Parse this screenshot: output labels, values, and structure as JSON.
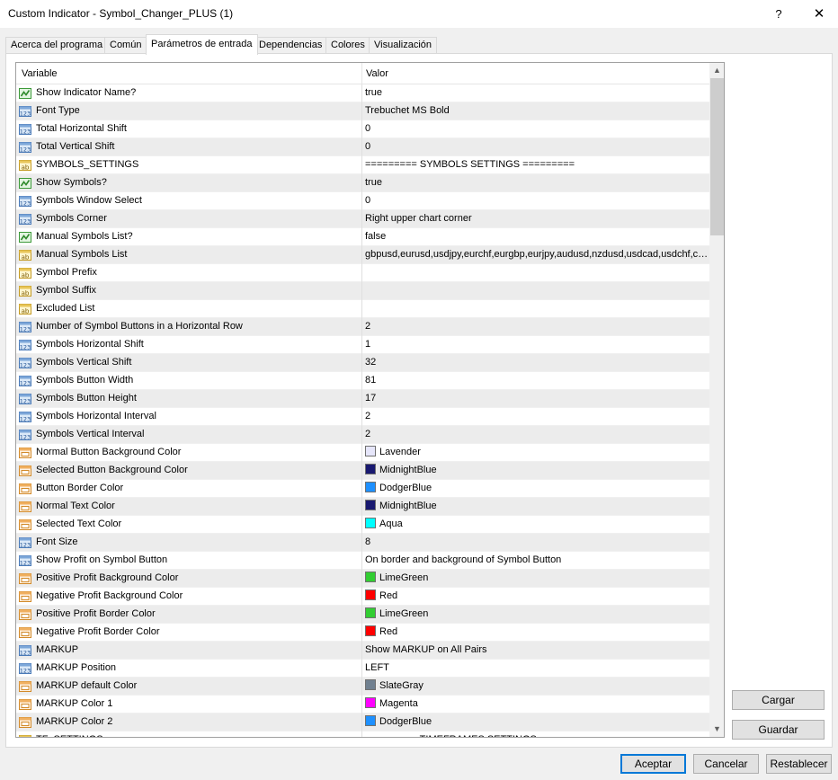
{
  "window": {
    "title": "Custom Indicator - Symbol_Changer_PLUS (1)",
    "help_label": "?",
    "close_label": "✕"
  },
  "tabs": [
    {
      "label": "Acerca del programa",
      "active": false
    },
    {
      "label": "Común",
      "active": false
    },
    {
      "label": "Parámetros de entrada",
      "active": true
    },
    {
      "label": "Dependencias",
      "active": false
    },
    {
      "label": "Colores",
      "active": false
    },
    {
      "label": "Visualización",
      "active": false
    }
  ],
  "grid": {
    "headers": {
      "variable": "Variable",
      "value": "Valor"
    },
    "rows": [
      {
        "type": "bool",
        "name": "Show Indicator Name?",
        "value": "true"
      },
      {
        "type": "int",
        "name": "Font Type",
        "value": "Trebuchet MS Bold"
      },
      {
        "type": "int",
        "name": "Total Horizontal Shift",
        "value": "0"
      },
      {
        "type": "int",
        "name": "Total Vertical Shift",
        "value": "0"
      },
      {
        "type": "string",
        "name": "SYMBOLS_SETTINGS",
        "value": "========= SYMBOLS SETTINGS ========="
      },
      {
        "type": "bool",
        "name": "Show Symbols?",
        "value": "true"
      },
      {
        "type": "int",
        "name": "Symbols Window Select",
        "value": "0"
      },
      {
        "type": "int",
        "name": "Symbols Corner",
        "value": "Right upper chart corner"
      },
      {
        "type": "bool",
        "name": "Manual Symbols List?",
        "value": "false"
      },
      {
        "type": "string",
        "name": "Manual Symbols List",
        "value": "gbpusd,eurusd,usdjpy,eurchf,eurgbp,eurjpy,audusd,nzdusd,usdcad,usdchf,ch..."
      },
      {
        "type": "string",
        "name": "Symbol Prefix",
        "value": ""
      },
      {
        "type": "string",
        "name": "Symbol Suffix",
        "value": ""
      },
      {
        "type": "string",
        "name": "Excluded List",
        "value": ""
      },
      {
        "type": "int",
        "name": "Number of Symbol Buttons in a Horizontal Row",
        "value": "2"
      },
      {
        "type": "int",
        "name": "Symbols Horizontal Shift",
        "value": "1"
      },
      {
        "type": "int",
        "name": "Symbols Vertical Shift",
        "value": "32"
      },
      {
        "type": "int",
        "name": "Symbols Button Width",
        "value": "81"
      },
      {
        "type": "int",
        "name": "Symbols Button Height",
        "value": "17"
      },
      {
        "type": "int",
        "name": "Symbols Horizontal Interval",
        "value": "2"
      },
      {
        "type": "int",
        "name": "Symbols Vertical Interval",
        "value": "2"
      },
      {
        "type": "color",
        "name": "Normal Button Background Color",
        "value": "Lavender",
        "swatch": "#e6e6fa"
      },
      {
        "type": "color",
        "name": "Selected Button Background Color",
        "value": "MidnightBlue",
        "swatch": "#191970"
      },
      {
        "type": "color",
        "name": "Button Border Color",
        "value": "DodgerBlue",
        "swatch": "#1e90ff"
      },
      {
        "type": "color",
        "name": "Normal Text Color",
        "value": "MidnightBlue",
        "swatch": "#191970"
      },
      {
        "type": "color",
        "name": "Selected Text Color",
        "value": "Aqua",
        "swatch": "#00ffff"
      },
      {
        "type": "int",
        "name": "Font Size",
        "value": "8"
      },
      {
        "type": "int",
        "name": "Show Profit on Symbol Button",
        "value": "On border and background of Symbol Button"
      },
      {
        "type": "color",
        "name": "Positive Profit Background Color",
        "value": "LimeGreen",
        "swatch": "#32cd32"
      },
      {
        "type": "color",
        "name": "Negative Profit Background Color",
        "value": "Red",
        "swatch": "#ff0000"
      },
      {
        "type": "color",
        "name": "Positive Profit Border Color",
        "value": "LimeGreen",
        "swatch": "#32cd32"
      },
      {
        "type": "color",
        "name": "Negative Profit Border Color",
        "value": "Red",
        "swatch": "#ff0000"
      },
      {
        "type": "int",
        "name": "MARKUP",
        "value": "Show MARKUP on All Pairs"
      },
      {
        "type": "int",
        "name": "MARKUP Position",
        "value": "LEFT"
      },
      {
        "type": "color",
        "name": "MARKUP default Color",
        "value": "SlateGray",
        "swatch": "#708090"
      },
      {
        "type": "color",
        "name": "MARKUP Color 1",
        "value": "Magenta",
        "swatch": "#ff00ff"
      },
      {
        "type": "color",
        "name": "MARKUP Color 2",
        "value": "DodgerBlue",
        "swatch": "#1e90ff"
      },
      {
        "type": "string",
        "name": "TF_SETTINGS",
        "value": "========= TIMEFRAMES SETTINGS ========="
      }
    ]
  },
  "side_buttons": {
    "load_label": "Cargar",
    "save_label": "Guardar"
  },
  "footer": {
    "ok_label": "Aceptar",
    "cancel_label": "Cancelar",
    "reset_label": "Restablecer"
  },
  "colors": {
    "accent": "#0078d7",
    "row_alt": "#ececec"
  }
}
